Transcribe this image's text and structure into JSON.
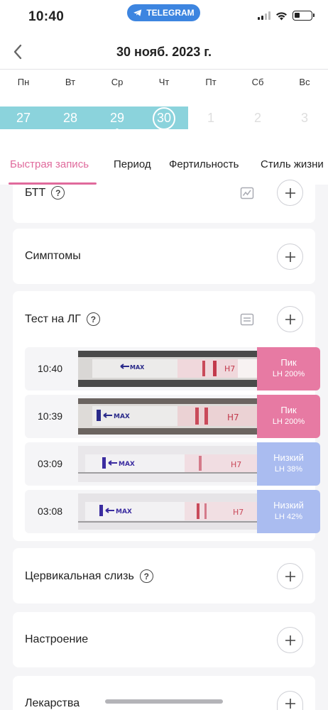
{
  "status_bar": {
    "time": "10:40",
    "pill_label": "TELEGRAM"
  },
  "header": {
    "title": "30 нояб. 2023 г."
  },
  "calendar": {
    "weekdays": [
      "Пн",
      "Вт",
      "Ср",
      "Чт",
      "Пт",
      "Сб",
      "Вс"
    ],
    "days": [
      "27",
      "28",
      "29",
      "30",
      "1",
      "2",
      "3"
    ],
    "selected_day": "30",
    "period_color": "#8bd3dc"
  },
  "tabs": [
    "Быстрая запись",
    "Период",
    "Фертильность",
    "Стиль жизни"
  ],
  "active_tab": "Быстрая запись",
  "cards": {
    "bbt": {
      "title": "БТТ"
    },
    "symptoms": {
      "title": "Симптомы"
    },
    "lh_test": {
      "title": "Тест на ЛГ",
      "entries": [
        {
          "time": "10:40",
          "level": "Пик",
          "value": "LH 200%",
          "color": "#e77aa3"
        },
        {
          "time": "10:39",
          "level": "Пик",
          "value": "LH 200%",
          "color": "#e77aa3"
        },
        {
          "time": "03:09",
          "level": "Низкий",
          "value": "LH 38%",
          "color": "#aabcf0"
        },
        {
          "time": "03:08",
          "level": "Низкий",
          "value": "LH 42%",
          "color": "#aabcf0"
        }
      ]
    },
    "cervical": {
      "title": "Цервикальная слизь"
    },
    "mood": {
      "title": "Настроение"
    },
    "meds": {
      "title": "Лекарства"
    }
  },
  "accent_color": "#e06a9c",
  "icons": [
    "telegram-icon",
    "signal-icon",
    "wifi-icon",
    "battery-icon",
    "back-chevron-icon",
    "help-icon",
    "chart-icon",
    "list-icon",
    "plus-icon"
  ]
}
